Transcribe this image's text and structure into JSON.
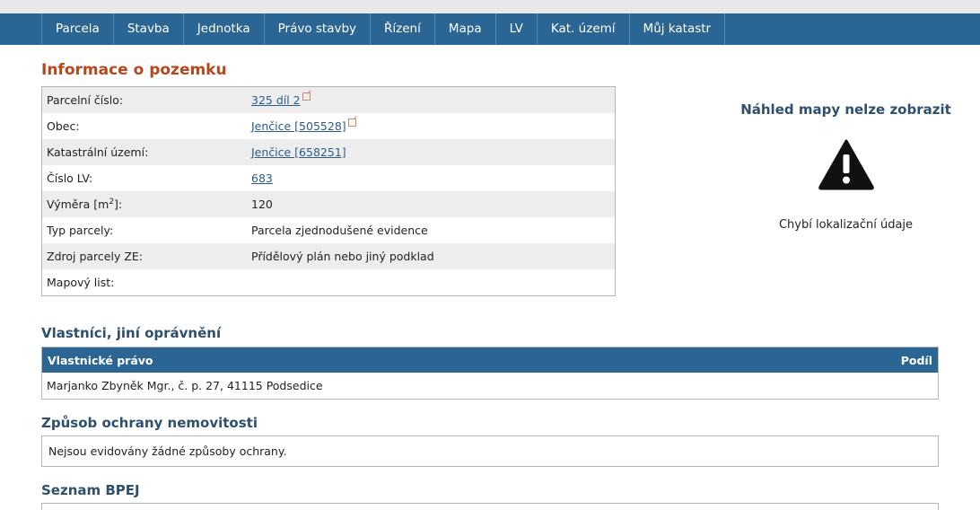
{
  "nav": {
    "items": [
      "Parcela",
      "Stavba",
      "Jednotka",
      "Právo stavby",
      "Řízení",
      "Mapa",
      "LV",
      "Kat. území",
      "Můj katastr"
    ]
  },
  "parcel": {
    "title": "Informace o pozemku",
    "rows": {
      "parcelni_cislo": {
        "label": "Parcelní číslo:",
        "value": "325 díl 2"
      },
      "obec": {
        "label": "Obec:",
        "value": "Jenčice [505528]"
      },
      "katastralni_uzemi": {
        "label": "Katastrální území:",
        "value": "Jenčice [658251]"
      },
      "cislo_lv": {
        "label": "Číslo LV:",
        "value": "683"
      },
      "vymera": {
        "label_prefix": "Výměra [m",
        "label_sup": "2",
        "label_suffix": "]:",
        "value": "120"
      },
      "typ_parcely": {
        "label": "Typ parcely:",
        "value": "Parcela zjednodušené evidence"
      },
      "zdroj": {
        "label": "Zdroj parcely ZE:",
        "value": "Přídělový plán nebo jiný podklad"
      },
      "mapovy_list": {
        "label": "Mapový list:",
        "value": ""
      }
    }
  },
  "map_preview": {
    "title": "Náhled mapy nelze zobrazit",
    "icon": "warning-triangle-icon",
    "message": "Chybí lokalizační údaje"
  },
  "owners": {
    "title": "Vlastníci, jiní oprávnění",
    "col_right": "Vlastnické právo",
    "col_share": "Podíl",
    "rows": [
      "Marjanko Zbyněk Mgr., č. p. 27, 41115 Podsedice"
    ]
  },
  "protection": {
    "title": "Způsob ochrany nemovitosti",
    "text": "Nejsou evidovány žádné způsoby ochrany."
  },
  "bpej": {
    "title": "Seznam BPEJ"
  },
  "colors": {
    "nav_bg": "#2a6593",
    "title_accent": "#b8461d",
    "heading": "#2f4f6e",
    "link": "#2a5d8a"
  }
}
